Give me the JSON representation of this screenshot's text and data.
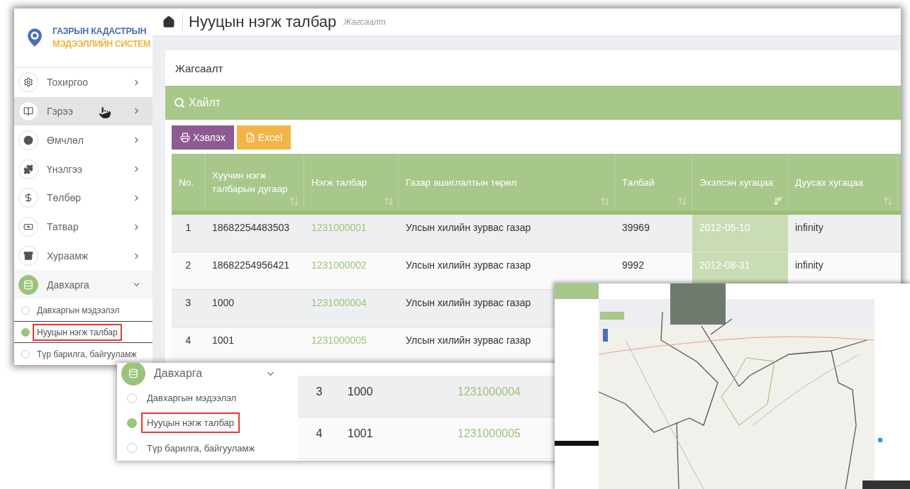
{
  "main_window": {
    "logo": {
      "line1": "ГАЗРЫН КАДАСТРЫН",
      "line2": "МЭДЭЭЛЛИЙН СИСТЕМ"
    },
    "nav": [
      {
        "label": "Тохиргоо",
        "kind": "settings",
        "hovered": false,
        "expanded": false
      },
      {
        "label": "Гэрээ",
        "kind": "book",
        "hovered": true,
        "expanded": false
      },
      {
        "label": "Өмчлөл",
        "kind": "dot",
        "hovered": false,
        "expanded": false
      },
      {
        "label": "Үнэлгээ",
        "kind": "puzzle",
        "hovered": false,
        "expanded": false
      },
      {
        "label": "Төлбөр",
        "kind": "dollar",
        "hovered": false,
        "expanded": false
      },
      {
        "label": "Татвар",
        "kind": "money",
        "hovered": false,
        "expanded": false
      },
      {
        "label": "Хураамж",
        "kind": "archive",
        "hovered": false,
        "expanded": false
      },
      {
        "label": "Давхарга",
        "kind": "layers",
        "hovered": false,
        "expanded": true,
        "children": [
          {
            "label": "Давхаргын мэдээлэл",
            "selected": false
          },
          {
            "label": "Нууцын нэгж талбар",
            "selected": true
          },
          {
            "label": "Түр барилга, байгууламж",
            "selected": false
          }
        ]
      }
    ],
    "page_title": "Нууцын нэгж талбар",
    "page_subtitle": "Жагсаалт",
    "panel_title": "Жагсаалт",
    "search_title": "Хайлт",
    "buttons": [
      {
        "label": "Хэвлэх",
        "kind": "print"
      },
      {
        "label": "Excel",
        "kind": "excel"
      }
    ],
    "table": {
      "columns": [
        {
          "label": "No.",
          "kind": "text",
          "sortable": false
        },
        {
          "label": "Хуучин нэгж талбарын дугаар",
          "kind": "text",
          "sortable": true,
          "sorted": false
        },
        {
          "label": "Нэгж талбар",
          "kind": "link",
          "sortable": true,
          "sorted": false
        },
        {
          "label": "Газар ашиглалтын төрөл",
          "kind": "text",
          "sortable": true,
          "sorted": false
        },
        {
          "label": "Талбай",
          "kind": "text",
          "sortable": true,
          "sorted": false
        },
        {
          "label": "Эхэлсэн хугацаа",
          "kind": "text",
          "sortable": true,
          "sorted": true
        },
        {
          "label": "Дуусах хугацаа",
          "kind": "text",
          "sortable": true,
          "sorted": false
        }
      ],
      "rows": [
        {
          "cells": [
            "1",
            "18682254483503",
            "1231000001",
            "Улсын хилийн зурвас газар",
            "39969",
            "2012-05-10",
            "infinity"
          ]
        },
        {
          "cells": [
            "2",
            "18682254956421",
            "1231000002",
            "Улсын хилийн зурвас газар",
            "9992",
            "2012-08-31",
            "infinity"
          ]
        },
        {
          "cells": [
            "3",
            "1000",
            "1231000004",
            "Улсын хилийн зурвас газар"
          ]
        },
        {
          "cells": [
            "4",
            "1001",
            "1231000005",
            "Улсын хилийн зурвас газар"
          ]
        }
      ]
    }
  },
  "inset": {
    "nav_parent": {
      "label": "Давхарга",
      "kind": "layers",
      "expanded": true
    },
    "nav_children": [
      {
        "label": "Давхаргын мэдээлэл",
        "selected": false
      },
      {
        "label": "Нууцын нэгж талбар",
        "selected": true
      },
      {
        "label": "Түр барилга, байгууламж",
        "selected": false
      }
    ],
    "rows": [
      {
        "cells": [
          "3",
          "1000",
          "1231000004"
        ]
      },
      {
        "cells": [
          "4",
          "1001",
          "1231000005"
        ]
      }
    ]
  }
}
